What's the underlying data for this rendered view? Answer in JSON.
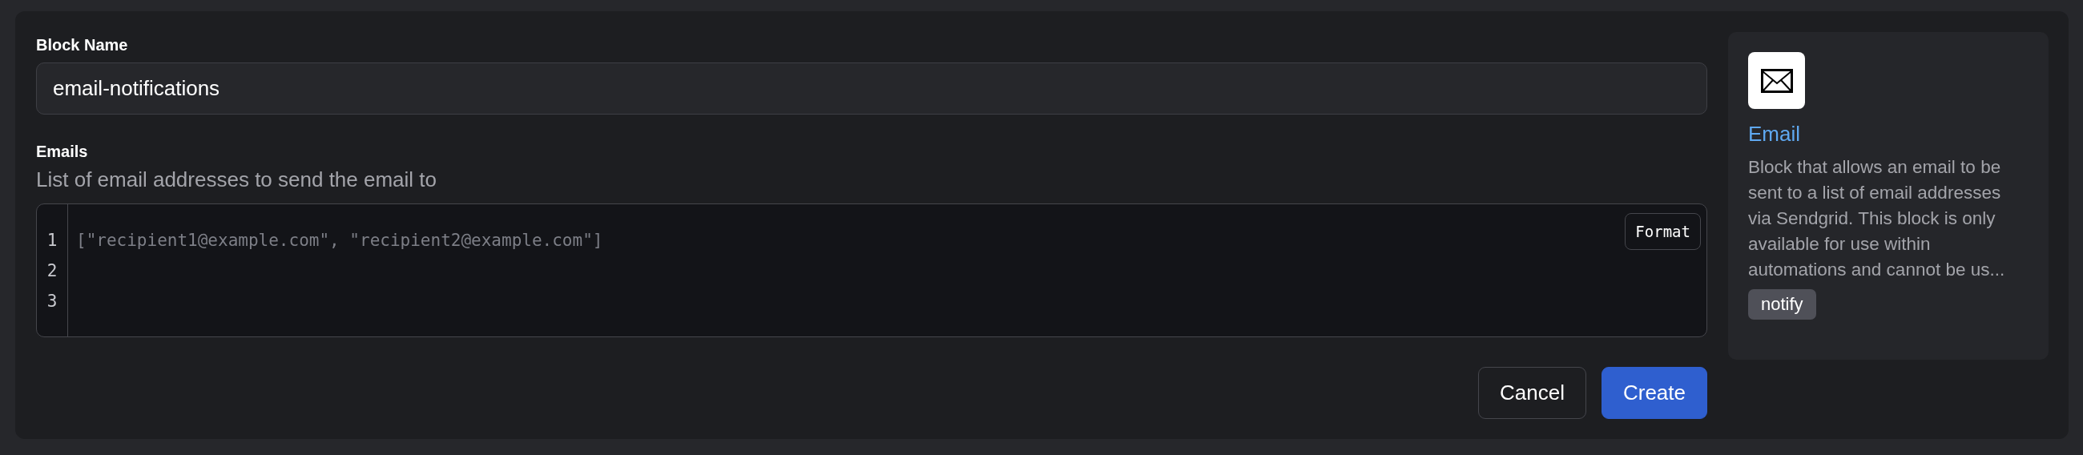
{
  "form": {
    "fields": [
      {
        "kind": "text",
        "label": "Block Name",
        "value": "email-notifications"
      },
      {
        "kind": "code",
        "label": "Emails",
        "description": "List of email addresses to send the email to",
        "line_numbers": [
          "1",
          "2",
          "3"
        ],
        "placeholder": "[\"recipient1@example.com\", \"recipient2@example.com\"]",
        "format_button": "Format"
      }
    ],
    "buttons": [
      {
        "label": "Cancel",
        "kind": "secondary"
      },
      {
        "label": "Create",
        "kind": "primary"
      }
    ]
  },
  "block_card": {
    "title": "Email",
    "description": "Block that allows an email to be sent to a list of email addresses via Sendgrid. This block is only available for use within automations and cannot be us...",
    "tags": [
      "notify"
    ]
  }
}
